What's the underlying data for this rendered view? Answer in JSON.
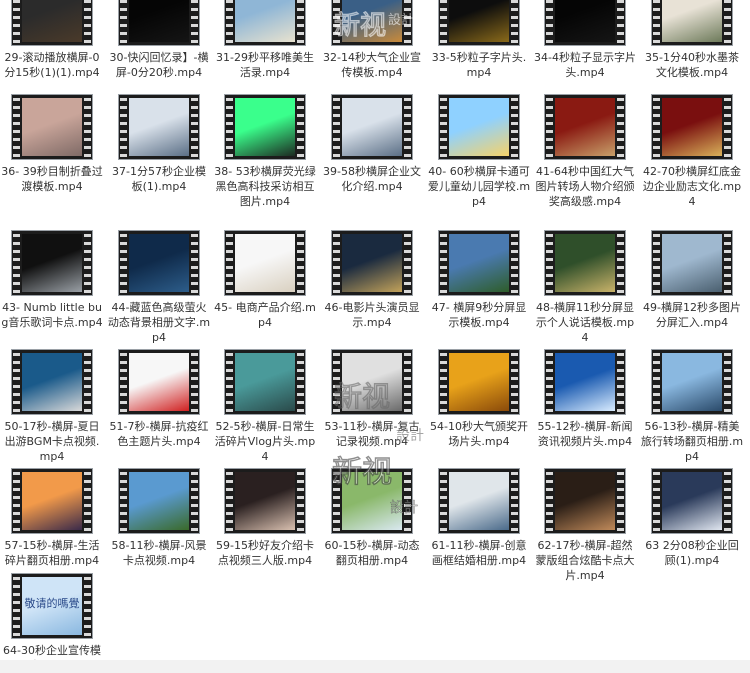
{
  "files": [
    {
      "name": "29-滚动播放横屏-0分15秒(1)(1).mp4",
      "thumb": "dark"
    },
    {
      "name": "30-快闪回忆录】-横屏-0分20秒.mp4",
      "thumb": "black"
    },
    {
      "name": "31-29秒平移唯美生活录.mp4",
      "thumb": "sky"
    },
    {
      "name": "32-14秒大气企业宣传模板.mp4",
      "thumb": "city"
    },
    {
      "name": "33-5秒粒子字片头.mp4",
      "thumb": "gold"
    },
    {
      "name": "34-4秒粒子显示字片头.mp4",
      "thumb": "black"
    },
    {
      "name": "35-1分40秒水墨茶文化模板.mp4",
      "thumb": "tea"
    },
    {
      "name": "36-  39秒目制折叠过渡模板.mp4",
      "thumb": "pink"
    },
    {
      "name": "37-1分57秒企业模板(1).mp4",
      "thumb": "office"
    },
    {
      "name": "38- 53秒横屏荧光绿黑色高科技采访相互图片.mp4",
      "thumb": "green"
    },
    {
      "name": "39-58秒横屏企业文化介绍.mp4",
      "thumb": "office"
    },
    {
      "name": "40- 60秒横屏卡通可爱儿童幼儿园学校.mp4",
      "thumb": "cartoon"
    },
    {
      "name": "41-64秒中国红大气图片转场人物介绍颁奖高级感.mp4",
      "thumb": "red"
    },
    {
      "name": "42-70秒横屏红底金边企业励志文化.mp4",
      "thumb": "redgold"
    },
    {
      "name": "43- Numb little bug音乐歌词卡点.mp4",
      "thumb": "car"
    },
    {
      "name": "44-藏蓝色高级萤火动态背景相册文字.mp4",
      "thumb": "navy"
    },
    {
      "name": "45- 电商产品介绍.mp4",
      "thumb": "white"
    },
    {
      "name": "46-电影片头演员显示.mp4",
      "thumb": "dusk"
    },
    {
      "name": "47- 横屏9秒分屏显示模板.mp4",
      "thumb": "split"
    },
    {
      "name": "48-横屏11秒分屏显示个人说话模板.mp4",
      "thumb": "forest"
    },
    {
      "name": "49-横屏12秒多图片分屏汇入.mp4",
      "thumb": "mountain"
    },
    {
      "name": "50-17秒-横屏-夏日出游BGM卡点视频.mp4",
      "thumb": "sea"
    },
    {
      "name": "51-7秒-横屏-抗疫红色主题片头.mp4",
      "thumb": "redwhite"
    },
    {
      "name": "52-5秒-横屏-日常生活碎片Vlog片头.mp4",
      "thumb": "teal"
    },
    {
      "name": "53-11秒-横屏-复古记录视频.mp4",
      "thumb": "vintage"
    },
    {
      "name": "54-10秒大气颁奖开场片头.mp4",
      "thumb": "award"
    },
    {
      "name": "55-12秒-横屏-新闻资讯视频片头.mp4",
      "thumb": "globe"
    },
    {
      "name": "56-13秒-横屏-精美旅行转场翻页相册.mp4",
      "thumb": "travel"
    },
    {
      "name": "57-15秒-横屏-生活碎片翻页相册.mp4",
      "thumb": "sunset"
    },
    {
      "name": "58-11秒-横屏-风景卡点视频.mp4",
      "thumb": "landscape"
    },
    {
      "name": "59-15秒好友介绍卡点视频三人版.mp4",
      "thumb": "portrait"
    },
    {
      "name": "60-15秒-横屏-动态翻页相册.mp4",
      "thumb": "field"
    },
    {
      "name": "61-11秒-横屏-创意画框结婚相册.mp4",
      "thumb": "wedding"
    },
    {
      "name": "62-17秒-横屏-超然蒙版组合炫酷卡点大片.mp4",
      "thumb": "kitchen"
    },
    {
      "name": "63  2分08秒企业回顾(1).mp4",
      "thumb": "meeting"
    },
    {
      "name": "64-30秒企业宣传模板.mp4",
      "thumb": "bluetext",
      "caption": "敬请的嗎覺"
    }
  ],
  "thumb_colors": {
    "dark": [
      "#2b2b2b",
      "#4a3a2a"
    ],
    "black": [
      "#050505",
      "#151515"
    ],
    "sky": [
      "#8fb6d6",
      "#e8e2cf"
    ],
    "city": [
      "#3a5f86",
      "#c98a3a"
    ],
    "gold": [
      "#0d0d0d",
      "#8a6a1a"
    ],
    "tea": [
      "#e8e2d6",
      "#6d7a5a"
    ],
    "pink": [
      "#c9a59a",
      "#7f6a66"
    ],
    "office": [
      "#d9e1ea",
      "#5b6f86"
    ],
    "green": [
      "#3aff8c",
      "#1d2a22"
    ],
    "cartoon": [
      "#8fd1ff",
      "#f6d36a"
    ],
    "red": [
      "#8a1a12",
      "#c8a06a"
    ],
    "redgold": [
      "#7a0f0f",
      "#d9b15a"
    ],
    "car": [
      "#101010",
      "#9aa0a6"
    ],
    "navy": [
      "#0f2a4a",
      "#2d5d8a"
    ],
    "white": [
      "#f7f7f7",
      "#d9d0c0"
    ],
    "dusk": [
      "#1a2a3f",
      "#c2a25a"
    ],
    "split": [
      "#4a7ab0",
      "#2e5d2a"
    ],
    "forest": [
      "#2f4f2a",
      "#c9b36a"
    ],
    "mountain": [
      "#9fb8cf",
      "#4a5f6f"
    ],
    "sea": [
      "#1a5a8a",
      "#d9d9d9"
    ],
    "redwhite": [
      "#f7f7f7",
      "#d02020"
    ],
    "teal": [
      "#4a9a9a",
      "#2a4a4a"
    ],
    "vintage": [
      "#e0e0e0",
      "#6a6a6a"
    ],
    "award": [
      "#e8a21a",
      "#8a4a0a"
    ],
    "globe": [
      "#1a5ab0",
      "#d9ecff"
    ],
    "travel": [
      "#8ab8e0",
      "#2a4a6a"
    ],
    "sunset": [
      "#f29a4a",
      "#3a2a4a"
    ],
    "landscape": [
      "#5a9ad0",
      "#3a6a2a"
    ],
    "portrait": [
      "#2a2020",
      "#d9c0b0"
    ],
    "field": [
      "#8ab86a",
      "#d9e8f0"
    ],
    "wedding": [
      "#e0e6ea",
      "#4a6a8a"
    ],
    "kitchen": [
      "#2a1e16",
      "#c08a5a"
    ],
    "meeting": [
      "#2a3a5a",
      "#e0e6f0"
    ],
    "bluetext": [
      "#cfe4f7",
      "#8ab8e0"
    ]
  },
  "watermark": {
    "line1": "新视",
    "line2": "設計"
  }
}
